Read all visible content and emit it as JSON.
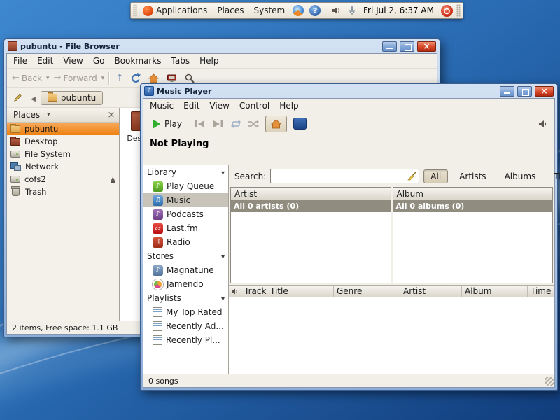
{
  "theme": {
    "selection_orange": "#f57900",
    "titlebar_blue": "#9db9e0",
    "panel_beige": "#f2efe9",
    "desktop_blue": "#2a6cb4",
    "close_button_red": "#d6472a"
  },
  "panel": {
    "menus": {
      "applications": "Applications",
      "places": "Places",
      "system": "System"
    },
    "clock": "Fri Jul 2, 6:37 AM"
  },
  "file_browser": {
    "title": "pubuntu - File Browser",
    "menu": {
      "file": "File",
      "edit": "Edit",
      "view": "View",
      "go": "Go",
      "bookmarks": "Bookmarks",
      "tabs": "Tabs",
      "help": "Help"
    },
    "toolbar": {
      "back": "Back",
      "forward": "Forward"
    },
    "location_button": "pubuntu",
    "sidebar": {
      "header": "Places",
      "items": [
        {
          "label": "pubuntu"
        },
        {
          "label": "Desktop"
        },
        {
          "label": "File System"
        },
        {
          "label": "Network"
        },
        {
          "label": "cofs2"
        },
        {
          "label": "Trash"
        }
      ]
    },
    "files": [
      {
        "label": "Desktop"
      }
    ],
    "statusbar": "2 items, Free space: 1.1 GB"
  },
  "music_player": {
    "title": "Music Player",
    "menu": {
      "music": "Music",
      "edit": "Edit",
      "view": "View",
      "control": "Control",
      "help": "Help"
    },
    "toolbar": {
      "play": "Play"
    },
    "now_playing": "Not Playing",
    "search": {
      "label": "Search:",
      "value": ""
    },
    "filters": {
      "all": "All",
      "artists": "Artists",
      "albums": "Albums",
      "titles": "Titles"
    },
    "sidebar": {
      "library": "Library",
      "play_queue": "Play Queue",
      "music": "Music",
      "podcasts": "Podcasts",
      "lastfm": "Last.fm",
      "radio": "Radio",
      "stores": "Stores",
      "magnatune": "Magnatune",
      "jamendo": "Jamendo",
      "playlists": "Playlists",
      "my_top_rated": "My Top Rated",
      "recently_added": "Recently Ad...",
      "recently_played": "Recently Pl..."
    },
    "artist_pane": {
      "header": "Artist",
      "summary": "All 0 artists (0)"
    },
    "album_pane": {
      "header": "Album",
      "summary": "All 0 albums (0)"
    },
    "track_list": {
      "columns": [
        "Track",
        "Title",
        "Genre",
        "Artist",
        "Album",
        "Time"
      ]
    },
    "statusbar": "0 songs"
  }
}
